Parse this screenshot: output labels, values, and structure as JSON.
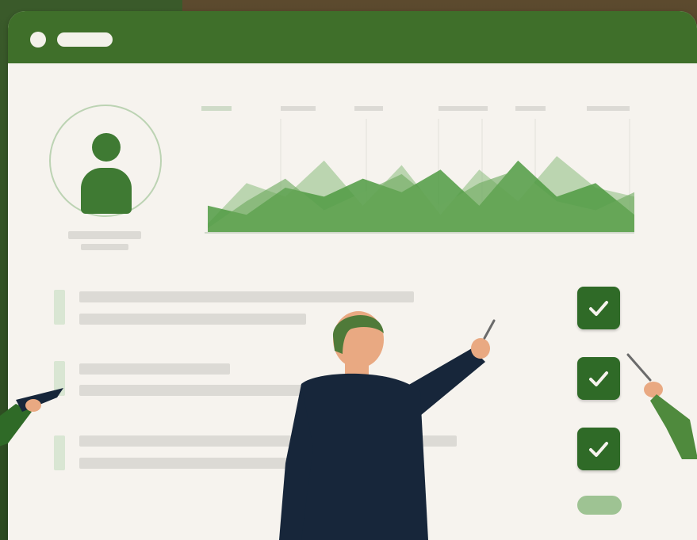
{
  "colors": {
    "primary_green": "#3f6f2a",
    "accent_green": "#3f7a33",
    "check_green": "#2f6a27",
    "light_green": "#9ec393",
    "panel_bg": "#f6f3ee",
    "suit": "#17263a"
  },
  "icons": {
    "window_dot": "circle",
    "avatar": "user-icon",
    "checks": [
      "check-icon",
      "check-icon",
      "check-icon"
    ]
  },
  "chart_data": {
    "type": "area",
    "series": [
      {
        "values": [
          10,
          55,
          40,
          80,
          30,
          75,
          20,
          70,
          35,
          85,
          50,
          40
        ]
      },
      {
        "values": [
          30,
          20,
          50,
          40,
          60,
          45,
          70,
          30,
          80,
          40,
          55,
          20
        ]
      },
      {
        "values": [
          5,
          35,
          60,
          25,
          45,
          65,
          30,
          55,
          70,
          35,
          25,
          45
        ]
      }
    ],
    "grid": true
  }
}
